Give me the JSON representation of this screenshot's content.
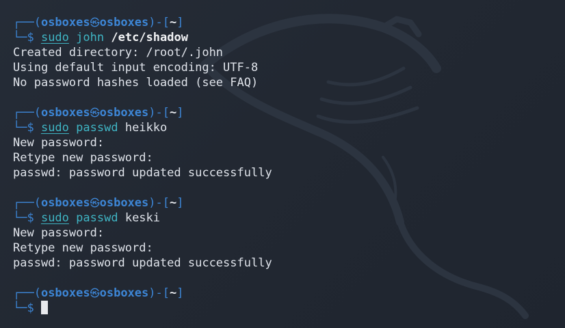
{
  "terminal": {
    "prompt": {
      "frame_top": "┌──(",
      "frame_mid": ")-[",
      "frame_end": "]",
      "frame_bottom": "└─$ ",
      "user": "osboxes",
      "skull": "㉿",
      "host": "osboxes",
      "dir": "~"
    },
    "blocks": [
      {
        "cmd": {
          "sudo": "sudo",
          "program": "john",
          "arg": "/etc/shadow",
          "arg_bold": true
        },
        "output": [
          "Created directory: /root/.john",
          "Using default input encoding: UTF-8",
          "No password hashes loaded (see FAQ)"
        ]
      },
      {
        "cmd": {
          "sudo": "sudo",
          "program": "passwd",
          "arg": "heikko",
          "arg_bold": false
        },
        "output": [
          "New password:",
          "Retype new password:",
          "passwd: password updated successfully"
        ]
      },
      {
        "cmd": {
          "sudo": "sudo",
          "program": "passwd",
          "arg": "keski",
          "arg_bold": false
        },
        "output": [
          "New password:",
          "Retype new password:",
          "passwd: password updated successfully"
        ]
      }
    ],
    "colors": {
      "background": "#222832",
      "prompt_blue": "#3d86d6",
      "command_cyan": "#3fb5c4",
      "text": "#dfe3ea"
    },
    "watermark_icon": "kali-dragon-icon"
  }
}
